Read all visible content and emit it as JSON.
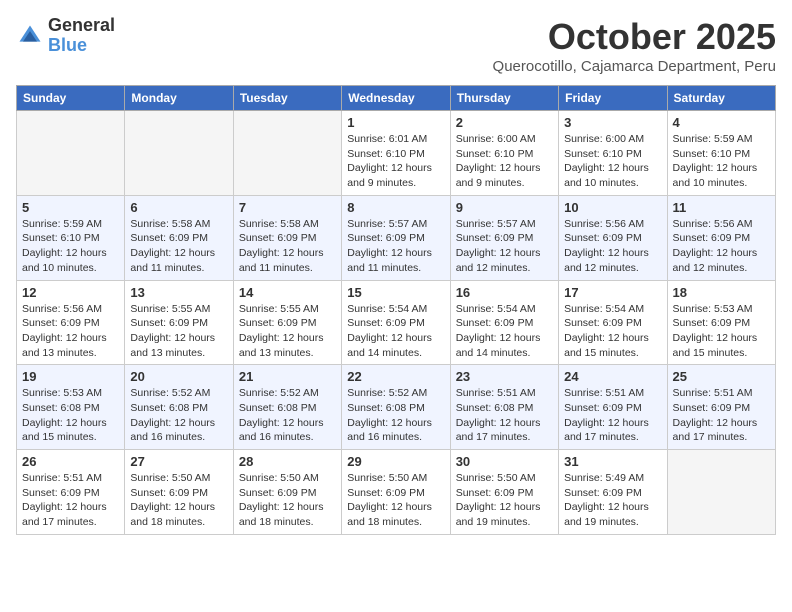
{
  "logo": {
    "general": "General",
    "blue": "Blue"
  },
  "header": {
    "month": "October 2025",
    "location": "Querocotillo, Cajamarca Department, Peru"
  },
  "weekdays": [
    "Sunday",
    "Monday",
    "Tuesday",
    "Wednesday",
    "Thursday",
    "Friday",
    "Saturday"
  ],
  "weeks": [
    [
      {
        "day": "",
        "info": ""
      },
      {
        "day": "",
        "info": ""
      },
      {
        "day": "",
        "info": ""
      },
      {
        "day": "1",
        "info": "Sunrise: 6:01 AM\nSunset: 6:10 PM\nDaylight: 12 hours\nand 9 minutes."
      },
      {
        "day": "2",
        "info": "Sunrise: 6:00 AM\nSunset: 6:10 PM\nDaylight: 12 hours\nand 9 minutes."
      },
      {
        "day": "3",
        "info": "Sunrise: 6:00 AM\nSunset: 6:10 PM\nDaylight: 12 hours\nand 10 minutes."
      },
      {
        "day": "4",
        "info": "Sunrise: 5:59 AM\nSunset: 6:10 PM\nDaylight: 12 hours\nand 10 minutes."
      }
    ],
    [
      {
        "day": "5",
        "info": "Sunrise: 5:59 AM\nSunset: 6:10 PM\nDaylight: 12 hours\nand 10 minutes."
      },
      {
        "day": "6",
        "info": "Sunrise: 5:58 AM\nSunset: 6:09 PM\nDaylight: 12 hours\nand 11 minutes."
      },
      {
        "day": "7",
        "info": "Sunrise: 5:58 AM\nSunset: 6:09 PM\nDaylight: 12 hours\nand 11 minutes."
      },
      {
        "day": "8",
        "info": "Sunrise: 5:57 AM\nSunset: 6:09 PM\nDaylight: 12 hours\nand 11 minutes."
      },
      {
        "day": "9",
        "info": "Sunrise: 5:57 AM\nSunset: 6:09 PM\nDaylight: 12 hours\nand 12 minutes."
      },
      {
        "day": "10",
        "info": "Sunrise: 5:56 AM\nSunset: 6:09 PM\nDaylight: 12 hours\nand 12 minutes."
      },
      {
        "day": "11",
        "info": "Sunrise: 5:56 AM\nSunset: 6:09 PM\nDaylight: 12 hours\nand 12 minutes."
      }
    ],
    [
      {
        "day": "12",
        "info": "Sunrise: 5:56 AM\nSunset: 6:09 PM\nDaylight: 12 hours\nand 13 minutes."
      },
      {
        "day": "13",
        "info": "Sunrise: 5:55 AM\nSunset: 6:09 PM\nDaylight: 12 hours\nand 13 minutes."
      },
      {
        "day": "14",
        "info": "Sunrise: 5:55 AM\nSunset: 6:09 PM\nDaylight: 12 hours\nand 13 minutes."
      },
      {
        "day": "15",
        "info": "Sunrise: 5:54 AM\nSunset: 6:09 PM\nDaylight: 12 hours\nand 14 minutes."
      },
      {
        "day": "16",
        "info": "Sunrise: 5:54 AM\nSunset: 6:09 PM\nDaylight: 12 hours\nand 14 minutes."
      },
      {
        "day": "17",
        "info": "Sunrise: 5:54 AM\nSunset: 6:09 PM\nDaylight: 12 hours\nand 15 minutes."
      },
      {
        "day": "18",
        "info": "Sunrise: 5:53 AM\nSunset: 6:09 PM\nDaylight: 12 hours\nand 15 minutes."
      }
    ],
    [
      {
        "day": "19",
        "info": "Sunrise: 5:53 AM\nSunset: 6:08 PM\nDaylight: 12 hours\nand 15 minutes."
      },
      {
        "day": "20",
        "info": "Sunrise: 5:52 AM\nSunset: 6:08 PM\nDaylight: 12 hours\nand 16 minutes."
      },
      {
        "day": "21",
        "info": "Sunrise: 5:52 AM\nSunset: 6:08 PM\nDaylight: 12 hours\nand 16 minutes."
      },
      {
        "day": "22",
        "info": "Sunrise: 5:52 AM\nSunset: 6:08 PM\nDaylight: 12 hours\nand 16 minutes."
      },
      {
        "day": "23",
        "info": "Sunrise: 5:51 AM\nSunset: 6:08 PM\nDaylight: 12 hours\nand 17 minutes."
      },
      {
        "day": "24",
        "info": "Sunrise: 5:51 AM\nSunset: 6:09 PM\nDaylight: 12 hours\nand 17 minutes."
      },
      {
        "day": "25",
        "info": "Sunrise: 5:51 AM\nSunset: 6:09 PM\nDaylight: 12 hours\nand 17 minutes."
      }
    ],
    [
      {
        "day": "26",
        "info": "Sunrise: 5:51 AM\nSunset: 6:09 PM\nDaylight: 12 hours\nand 17 minutes."
      },
      {
        "day": "27",
        "info": "Sunrise: 5:50 AM\nSunset: 6:09 PM\nDaylight: 12 hours\nand 18 minutes."
      },
      {
        "day": "28",
        "info": "Sunrise: 5:50 AM\nSunset: 6:09 PM\nDaylight: 12 hours\nand 18 minutes."
      },
      {
        "day": "29",
        "info": "Sunrise: 5:50 AM\nSunset: 6:09 PM\nDaylight: 12 hours\nand 18 minutes."
      },
      {
        "day": "30",
        "info": "Sunrise: 5:50 AM\nSunset: 6:09 PM\nDaylight: 12 hours\nand 19 minutes."
      },
      {
        "day": "31",
        "info": "Sunrise: 5:49 AM\nSunset: 6:09 PM\nDaylight: 12 hours\nand 19 minutes."
      },
      {
        "day": "",
        "info": ""
      }
    ]
  ]
}
